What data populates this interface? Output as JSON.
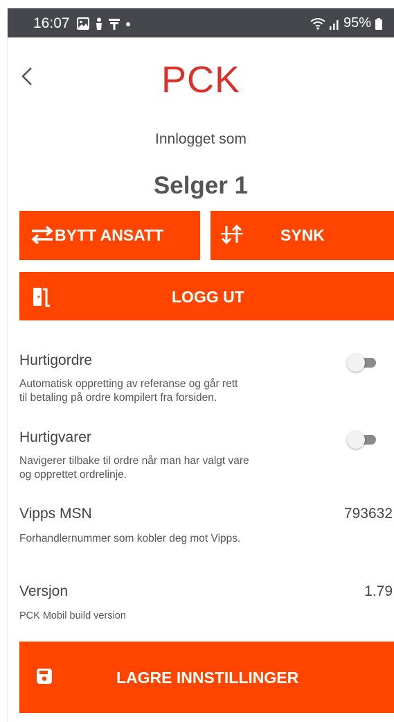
{
  "status_bar": {
    "time": "16:07",
    "battery": "95%"
  },
  "header": {
    "brand": "PCK"
  },
  "login": {
    "label": "Innlogget som",
    "user": "Selger 1"
  },
  "actions": {
    "switch_employee": "BYTT ANSATT",
    "sync": "SYNK",
    "logout": "LOGG UT",
    "save": "LAGRE INNSTILLINGER"
  },
  "settings": {
    "quick_order": {
      "title": "Hurtigordre",
      "desc_line1": "Automatisk oppretting av referanse og går rett",
      "desc_line2": "til betaling på ordre kompilert fra forsiden.",
      "enabled": false
    },
    "quick_items": {
      "title": "Hurtigvarer",
      "desc_line1": "Navigerer tilbake til ordre når man har valgt vare",
      "desc_line2": "og opprettet ordrelinje.",
      "enabled": false
    },
    "vipps_msn": {
      "title": "Vipps MSN",
      "value": "793632",
      "desc": "Forhandlernummer som kobler deg mot Vipps."
    },
    "version": {
      "title": "Versjon",
      "value": "1.79",
      "desc": "PCK Mobil build version"
    }
  },
  "colors": {
    "accent": "#ff4500",
    "brand": "#d9332c",
    "statusbar": "#45474c"
  }
}
